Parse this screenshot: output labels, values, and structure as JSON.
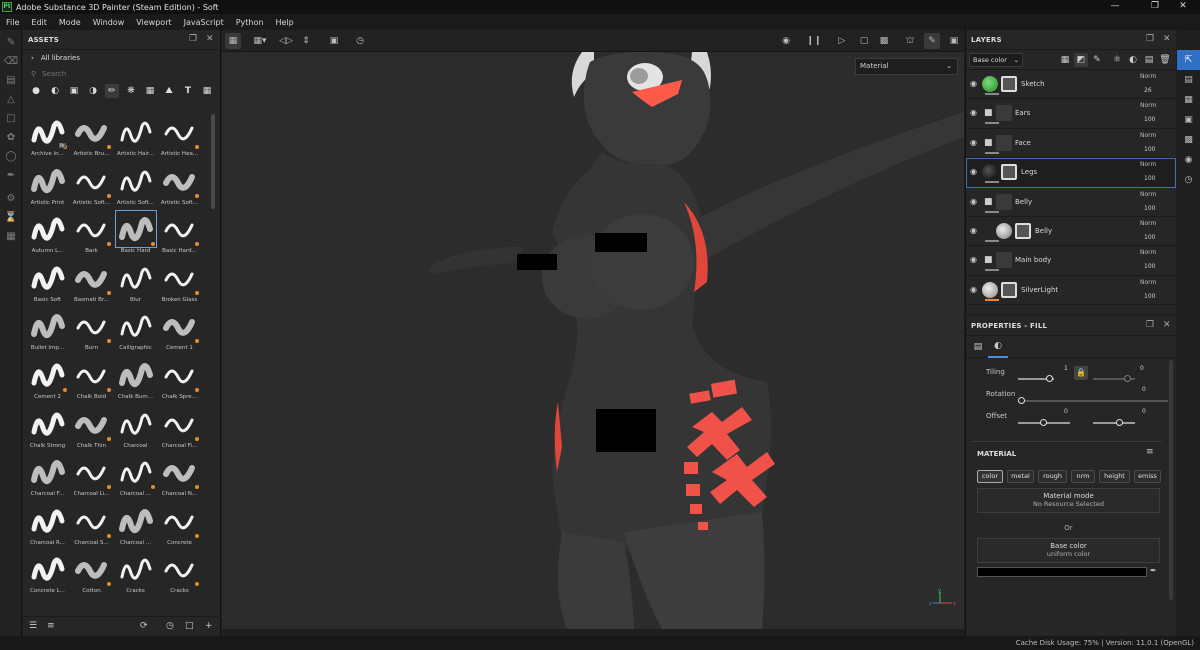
{
  "window": {
    "title": "Adobe Substance 3D Painter (Steam Edition) - Soft",
    "icon_label": "Pt"
  },
  "menu": [
    "File",
    "Edit",
    "Mode",
    "Window",
    "Viewport",
    "JavaScript",
    "Python",
    "Help"
  ],
  "assets": {
    "title": "ASSETS",
    "libraries_label": "All libraries",
    "search_placeholder": "Search",
    "tiles": [
      "Archive In...",
      "Artistic Bru...",
      "Artistic Hair...",
      "Artistic Hea...",
      "Artistic Print",
      "Artistic Soft...",
      "Artistic Soft...",
      "Artistic Soft...",
      "Autumn L...",
      "Bark",
      "Basic Hard",
      "Basic Hard...",
      "Basic Soft",
      "Basmati Br...",
      "Blur",
      "Broken Glass",
      "Bullet Imp...",
      "Burn",
      "Calligraphic",
      "Cement 1",
      "Cement 2",
      "Chalk Bold",
      "Chalk Bum...",
      "Chalk Spre...",
      "Chalk Strong",
      "Chalk Thin",
      "Charcoal",
      "Charcoal Fi...",
      "Charcoal F...",
      "Charcoal Li...",
      "Charcoal ...",
      "Charcoal N...",
      "Charcoal R...",
      "Charcoal S...",
      "Charcoal ...",
      "Concrete",
      "Concrete L...",
      "Cotton",
      "Cracks",
      "Cracks"
    ],
    "selected_tile": "Basic Hard",
    "archive_badge": "Ps"
  },
  "viewport": {
    "material_mode": "Material",
    "axis": {
      "x": "x",
      "y": "y",
      "z": "z"
    }
  },
  "layers": {
    "title": "LAYERS",
    "channel": "Base color",
    "rows": [
      {
        "name": "Sketch",
        "blend": "Norm",
        "opacity": "26"
      },
      {
        "name": "Ears",
        "blend": "Norm",
        "opacity": "100"
      },
      {
        "name": "Face",
        "blend": "Norm",
        "opacity": "100"
      },
      {
        "name": "Legs",
        "blend": "Norm",
        "opacity": "100"
      },
      {
        "name": "Belly",
        "blend": "Norm",
        "opacity": "100"
      },
      {
        "name": "Belly",
        "blend": "Norm",
        "opacity": "100"
      },
      {
        "name": "Main body",
        "blend": "Norm",
        "opacity": "100"
      },
      {
        "name": "SilverLight",
        "blend": "Norm",
        "opacity": "100"
      }
    ]
  },
  "properties": {
    "title": "PROPERTIES - FILL",
    "tiling_label": "Tiling",
    "tiling_value": "1",
    "rotation_label": "Rotation",
    "rotation_value": "0",
    "offset_label": "Offset",
    "offset_u": "0",
    "offset_v": "0",
    "tiling_v_value": "0",
    "material_header": "MATERIAL",
    "channels": [
      "color",
      "metal",
      "rough",
      "nrm",
      "height",
      "emiss"
    ],
    "material_mode_title": "Material mode",
    "material_mode_sub": "No Resource Selected",
    "or_label": "Or",
    "base_color_title": "Base color",
    "base_color_sub": "uniform color",
    "base_color_hex": "#000000"
  },
  "status": {
    "text": "Cache Disk Usage:  75% | Version: 11.0.1 (OpenGL)"
  }
}
